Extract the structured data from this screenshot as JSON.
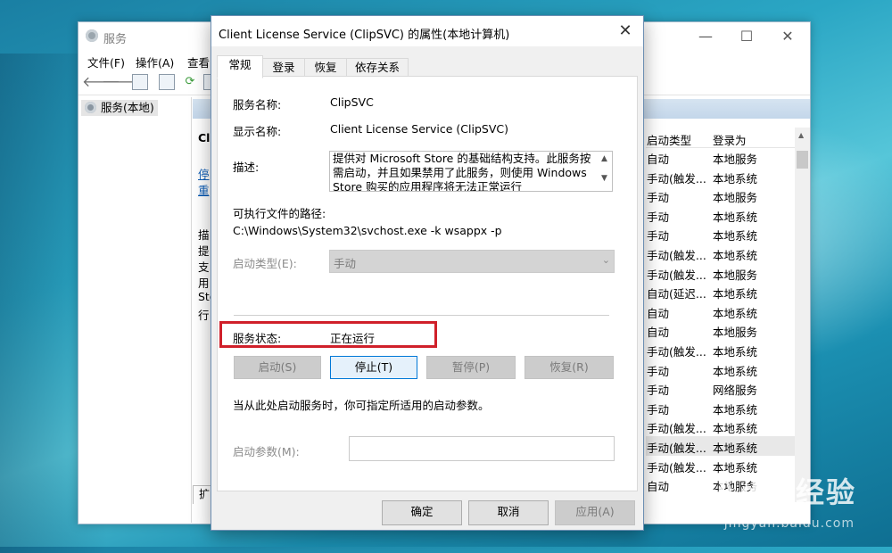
{
  "services_window": {
    "title": "服务",
    "menu": [
      "文件(F)",
      "操作(A)",
      "查看"
    ],
    "tree_item": "服务(本地)",
    "main_title_cut": "Cli",
    "links": [
      "停",
      "重"
    ],
    "desc_cut": [
      "描",
      "提",
      "支",
      "用",
      "Sto",
      "行"
    ],
    "list_headers": {
      "startup_type": "启动类型",
      "logon_as": "登录为"
    },
    "rows": [
      {
        "type": "自动",
        "logon": "本地服务"
      },
      {
        "type": "手动(触发...",
        "logon": "本地系统"
      },
      {
        "type": "手动",
        "logon": "本地服务"
      },
      {
        "type": "手动",
        "logon": "本地系统"
      },
      {
        "type": "手动",
        "logon": "本地系统"
      },
      {
        "type": "手动(触发...",
        "logon": "本地系统"
      },
      {
        "type": "手动(触发...",
        "logon": "本地服务"
      },
      {
        "type": "自动(延迟...",
        "logon": "本地系统"
      },
      {
        "type": "自动",
        "logon": "本地系统"
      },
      {
        "type": "自动",
        "logon": "本地服务"
      },
      {
        "type": "手动(触发...",
        "logon": "本地系统"
      },
      {
        "type": "手动",
        "logon": "本地系统"
      },
      {
        "type": "手动",
        "logon": "网络服务"
      },
      {
        "type": "手动",
        "logon": "本地系统"
      },
      {
        "type": "手动(触发...",
        "logon": "本地系统"
      },
      {
        "type": "手动(触发...",
        "logon": "本地系统"
      },
      {
        "type": "手动(触发...",
        "logon": "本地系统"
      },
      {
        "type": "自动",
        "logon": "本地服务"
      }
    ],
    "status_tab": "扩"
  },
  "dialog": {
    "title": "Client License Service (ClipSVC) 的属性(本地计算机)",
    "tabs": [
      "常规",
      "登录",
      "恢复",
      "依存关系"
    ],
    "service_name_label": "服务名称:",
    "service_name": "ClipSVC",
    "display_name_label": "显示名称:",
    "display_name": "Client License Service (ClipSVC)",
    "description_label": "描述:",
    "description": "提供对 Microsoft Store 的基础结构支持。此服务按需启动，并且如果禁用了此服务，则使用 Windows Store 购买的应用程序将无法正常运行",
    "path_label": "可执行文件的路径:",
    "path": "C:\\Windows\\System32\\svchost.exe -k wsappx -p",
    "startup_type_label": "启动类型(E):",
    "startup_type": "手动",
    "status_label": "服务状态:",
    "status": "正在运行",
    "buttons": {
      "start": "启动(S)",
      "stop": "停止(T)",
      "pause": "暂停(P)",
      "resume": "恢复(R)"
    },
    "hint": "当从此处启动服务时，你可指定所适用的启动参数。",
    "params_label": "启动参数(M):",
    "footer": {
      "ok": "确定",
      "cancel": "取消",
      "apply": "应用(A)"
    }
  },
  "watermark": {
    "brand": "Bai du 经验",
    "url": "jingyan.baidu.com"
  },
  "colors": {
    "highlight": "#d0202a",
    "focus": "#0078d7"
  }
}
